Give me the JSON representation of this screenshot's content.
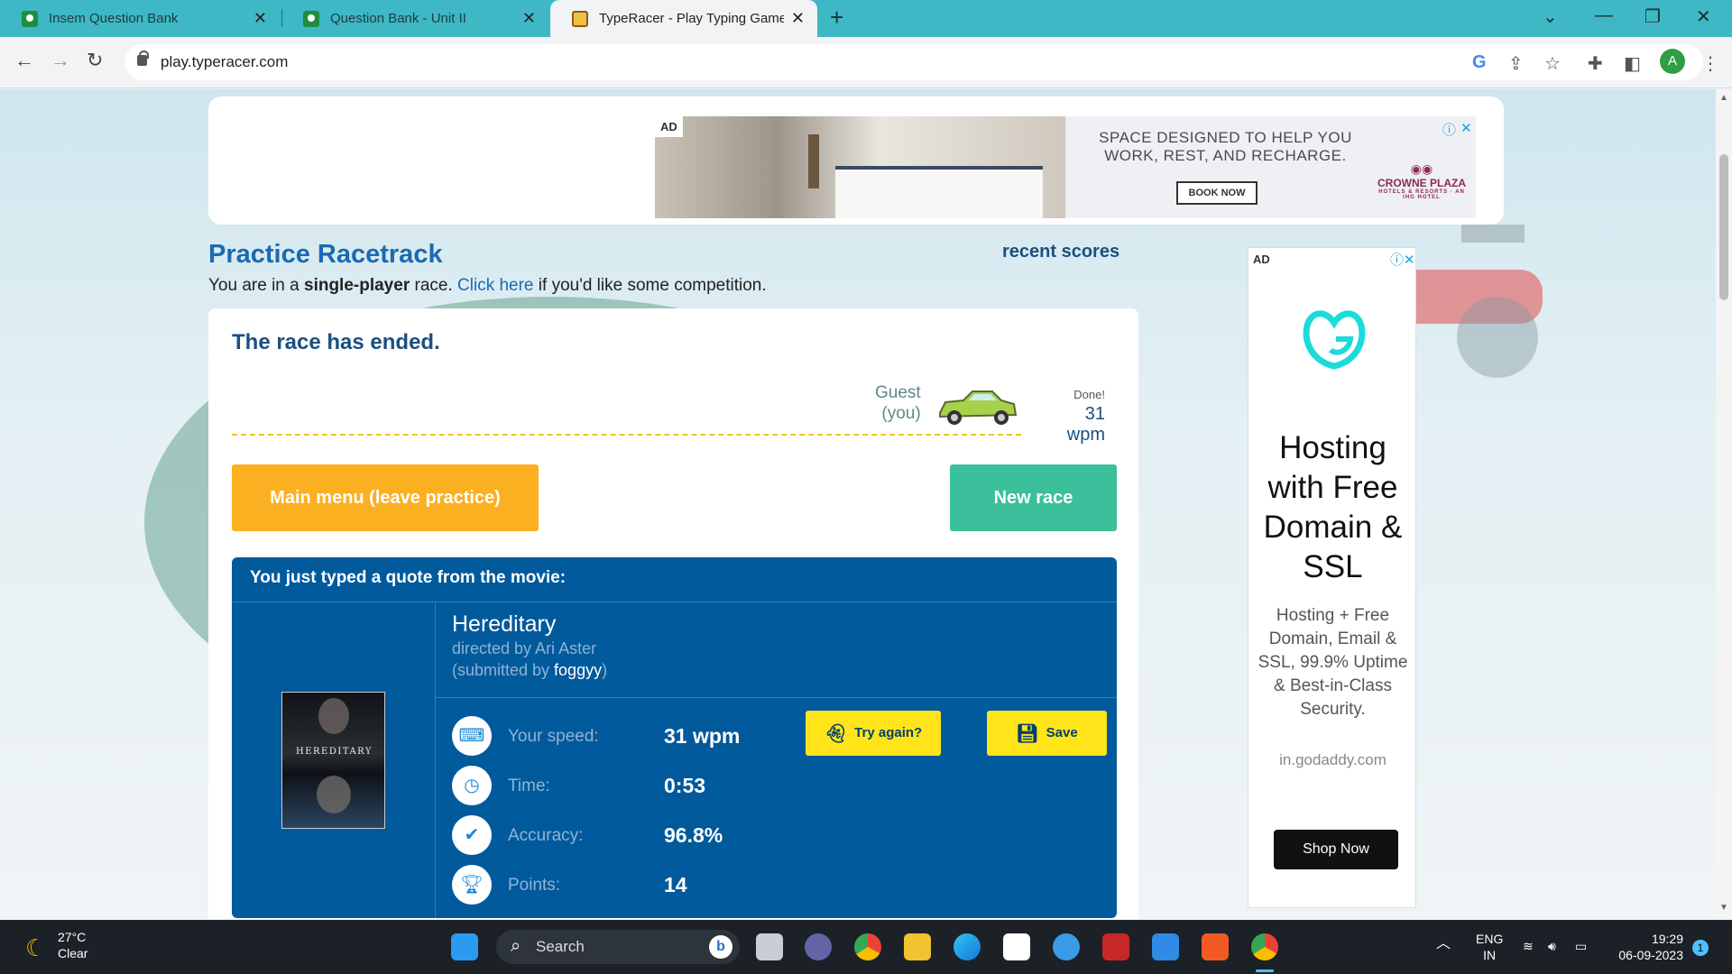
{
  "browser": {
    "tabs": [
      {
        "title": "Insem Question Bank",
        "active": false
      },
      {
        "title": "Question Bank - Unit II",
        "active": false
      },
      {
        "title": "TypeRacer - Play Typing Games a",
        "active": true
      }
    ],
    "url": "play.typeracer.com",
    "profile_initial": "A"
  },
  "top_ad": {
    "tag": "AD",
    "headline": "SPACE DESIGNED TO HELP YOU WORK, REST, AND RECHARGE.",
    "button": "BOOK NOW",
    "brand": "CROWNE PLAZA",
    "brand_sub": "HOTELS & RESORTS · AN IHG HOTEL"
  },
  "header": {
    "title": "Practice Racetrack",
    "sub_before": "You are in a ",
    "sub_bold": "single-player",
    "sub_mid": " race. ",
    "sub_link": "Click here",
    "sub_after": " if you'd like some competition.",
    "recent_scores": "recent scores"
  },
  "race": {
    "status": "The race has ended.",
    "player_name": "Guest",
    "player_you": "(you)",
    "done_label": "Done!",
    "wpm": "31 wpm",
    "main_menu_button": "Main menu (leave practice)",
    "new_race_button": "New race"
  },
  "result": {
    "heading": "You just typed a quote from the movie:",
    "poster_title": "HEREDITARY",
    "movie_title": "Hereditary",
    "director": "directed by Ari Aster",
    "submitted_prefix": "(submitted by ",
    "submitted_user": "foggyy",
    "submitted_suffix": ")",
    "stats": [
      {
        "label": "Your speed:",
        "value": "31 wpm",
        "icon": "keyboard-icon"
      },
      {
        "label": "Time:",
        "value": "0:53",
        "icon": "clock-icon"
      },
      {
        "label": "Accuracy:",
        "value": "96.8%",
        "icon": "check-icon"
      },
      {
        "label": "Points:",
        "value": "14",
        "icon": "trophy-icon"
      }
    ],
    "try_again_button": "Try again?",
    "save_button": "Save"
  },
  "side_ad": {
    "tag": "AD",
    "headline": "Hosting with Free Domain & SSL",
    "body": "Hosting + Free Domain, Email & SSL, 99.9% Uptime & Best-in-Class Security.",
    "domain": "in.godaddy.com",
    "button": "Shop Now"
  },
  "taskbar": {
    "temperature": "27°C",
    "condition": "Clear",
    "search_placeholder": "Search",
    "lang": "ENG",
    "region": "IN",
    "time": "19:29",
    "date": "06-09-2023",
    "notifications": "1"
  },
  "colors": {
    "tabstrip": "#3db8c4",
    "brand_blue": "#1b6ab0",
    "result_blue": "#005a9c",
    "main_menu_orange": "#fbb021",
    "new_race_green": "#3cc09c",
    "action_yellow": "#ffe419"
  }
}
